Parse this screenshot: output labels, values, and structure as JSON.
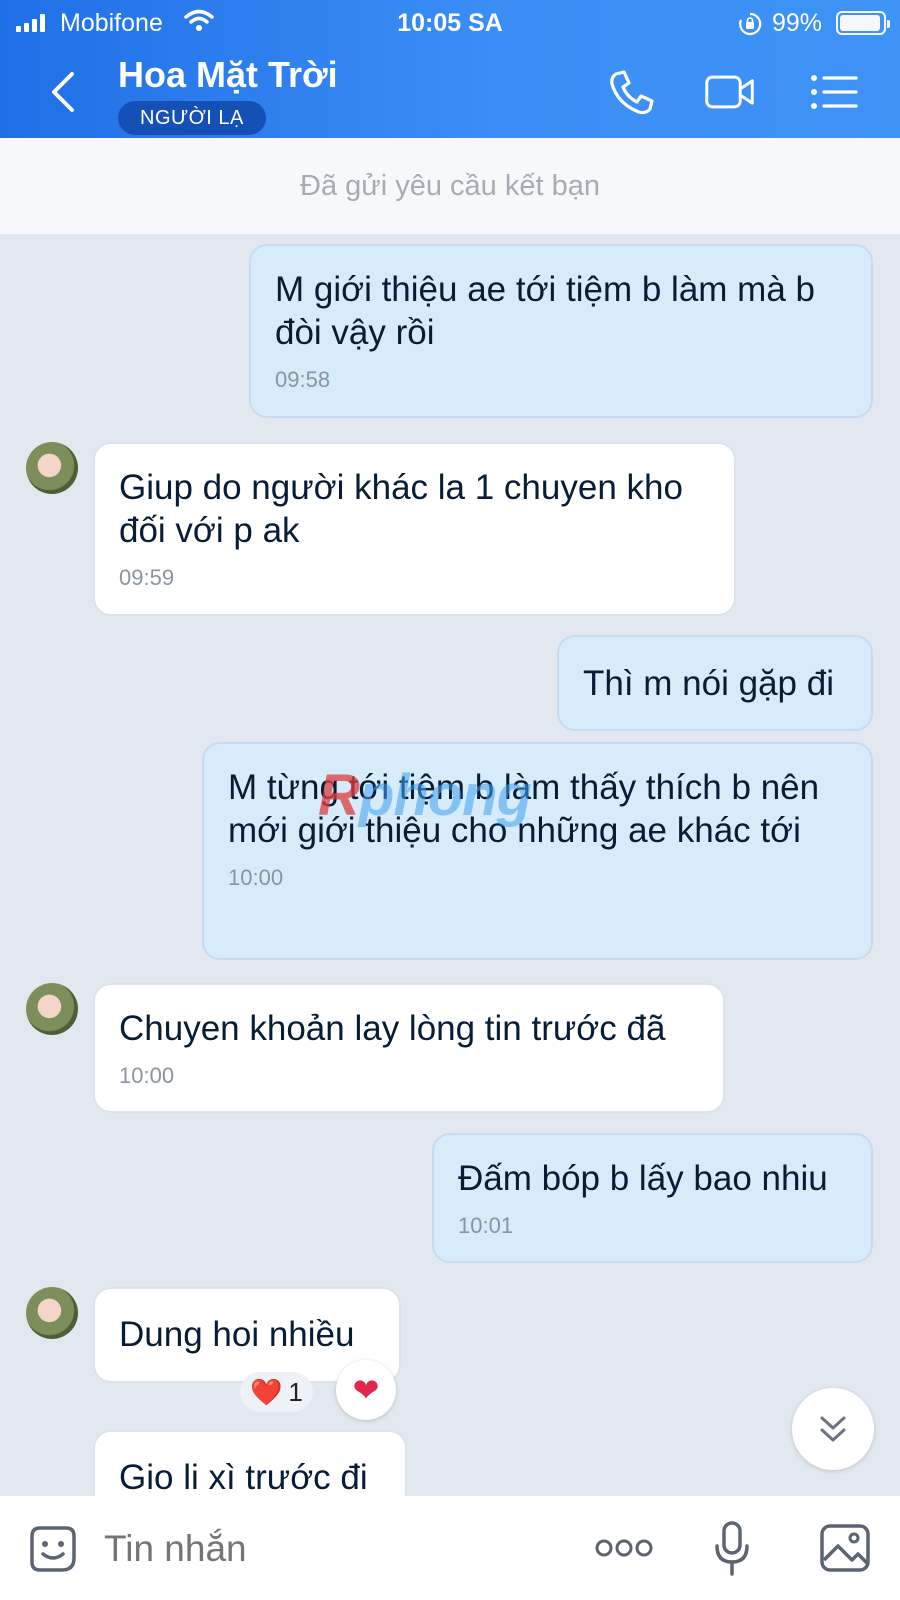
{
  "status_bar": {
    "carrier": "Mobifone",
    "time": "10:05 SA",
    "battery": "99%"
  },
  "header": {
    "title": "Hoa Mặt Trời",
    "badge": "NGƯỜI LẠ",
    "icons": [
      "back-icon",
      "phone-icon",
      "video-call-icon",
      "menu-list-icon"
    ]
  },
  "friend_request": {
    "text": "Đã gửi yêu cầu kết bạn"
  },
  "messages": [
    {
      "direction": "out",
      "text": "M giới thiệu ae tới tiệm b làm mà b đòi vậy rồi",
      "time": "09:58"
    },
    {
      "direction": "in",
      "text": "Giup do người khác la 1 chuyen kho đối với p ak",
      "time": "09:59"
    },
    {
      "direction": "out",
      "text": "Thì m nói gặp đi",
      "time": ""
    },
    {
      "direction": "out",
      "text": "M từng tới tiệm b làm thấy thích b nên mới giới thiệu cho những ae khác tới",
      "time": "10:00"
    },
    {
      "direction": "in",
      "text": "Chuyen khoản lay lòng tin trước đã",
      "time": "10:00"
    },
    {
      "direction": "out",
      "text": "Đấm bóp b lấy bao nhiu",
      "time": "10:01"
    },
    {
      "direction": "in",
      "text": "Dung hoi nhiều",
      "time": "",
      "reaction": {
        "emoji": "❤️",
        "count": "1"
      }
    },
    {
      "direction": "in",
      "text": "Gio li xì trước đi",
      "time": ""
    }
  ],
  "watermark": {
    "a": "R",
    "b": "phong"
  },
  "composer": {
    "placeholder": "Tin nhắn",
    "icons": [
      "sticker-icon",
      "more-dots-icon",
      "microphone-icon",
      "image-icon"
    ]
  },
  "colors": {
    "header_gradient_start": "#1f6fe6",
    "header_gradient_end": "#3e93f7",
    "outgoing_bubble": "#d6ecfb",
    "incoming_bubble": "#ffffff",
    "chat_background": "#e2e8ef"
  }
}
